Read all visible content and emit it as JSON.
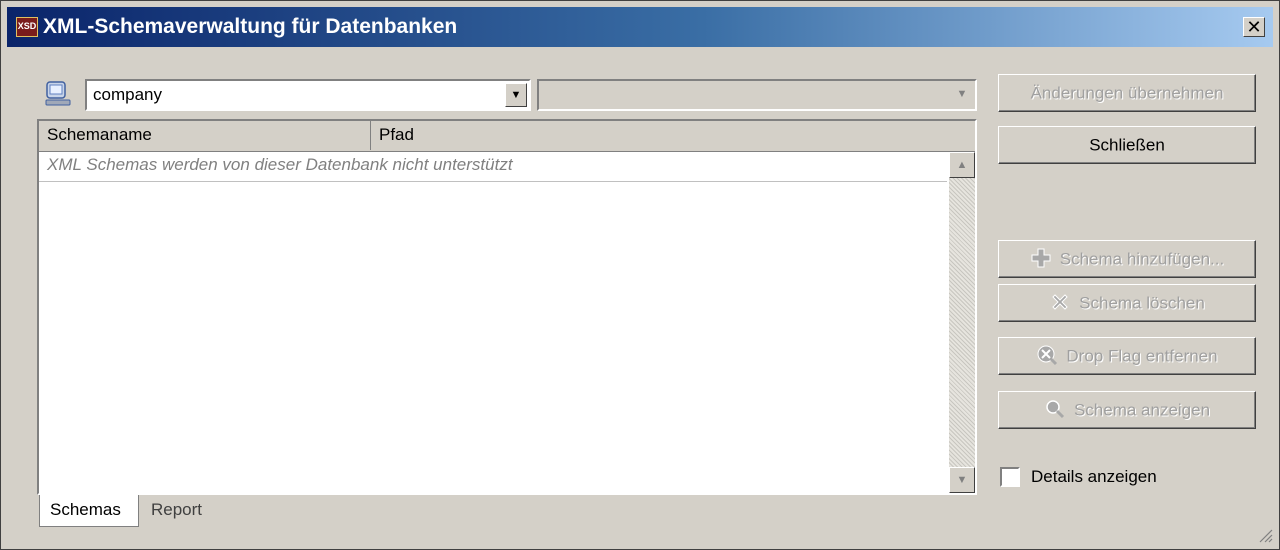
{
  "window": {
    "title": "XML-Schemaverwaltung für Datenbanken",
    "icon": "xsd-icon",
    "icon_text": "XSD"
  },
  "datasource": {
    "selected": "company",
    "secondary_selected": ""
  },
  "table": {
    "columns": [
      "Schemaname",
      "Pfad"
    ],
    "empty_message": "XML Schemas werden von dieser Datenbank nicht unterstützt"
  },
  "tabs": [
    {
      "label": "Schemas",
      "active": true
    },
    {
      "label": "Report",
      "active": false
    }
  ],
  "buttons": {
    "apply": "Änderungen übernehmen",
    "close": "Schließen",
    "add_schema": "Schema hinzufügen...",
    "delete_schema": "Schema löschen",
    "remove_drop_flag": "Drop Flag entfernen",
    "show_schema": "Schema anzeigen"
  },
  "details": {
    "label": "Details anzeigen",
    "checked": false
  },
  "colors": {
    "dialog": "#d4d0c8",
    "title_gradient_start": "#0a246a",
    "title_gradient_end": "#a6caf0"
  }
}
